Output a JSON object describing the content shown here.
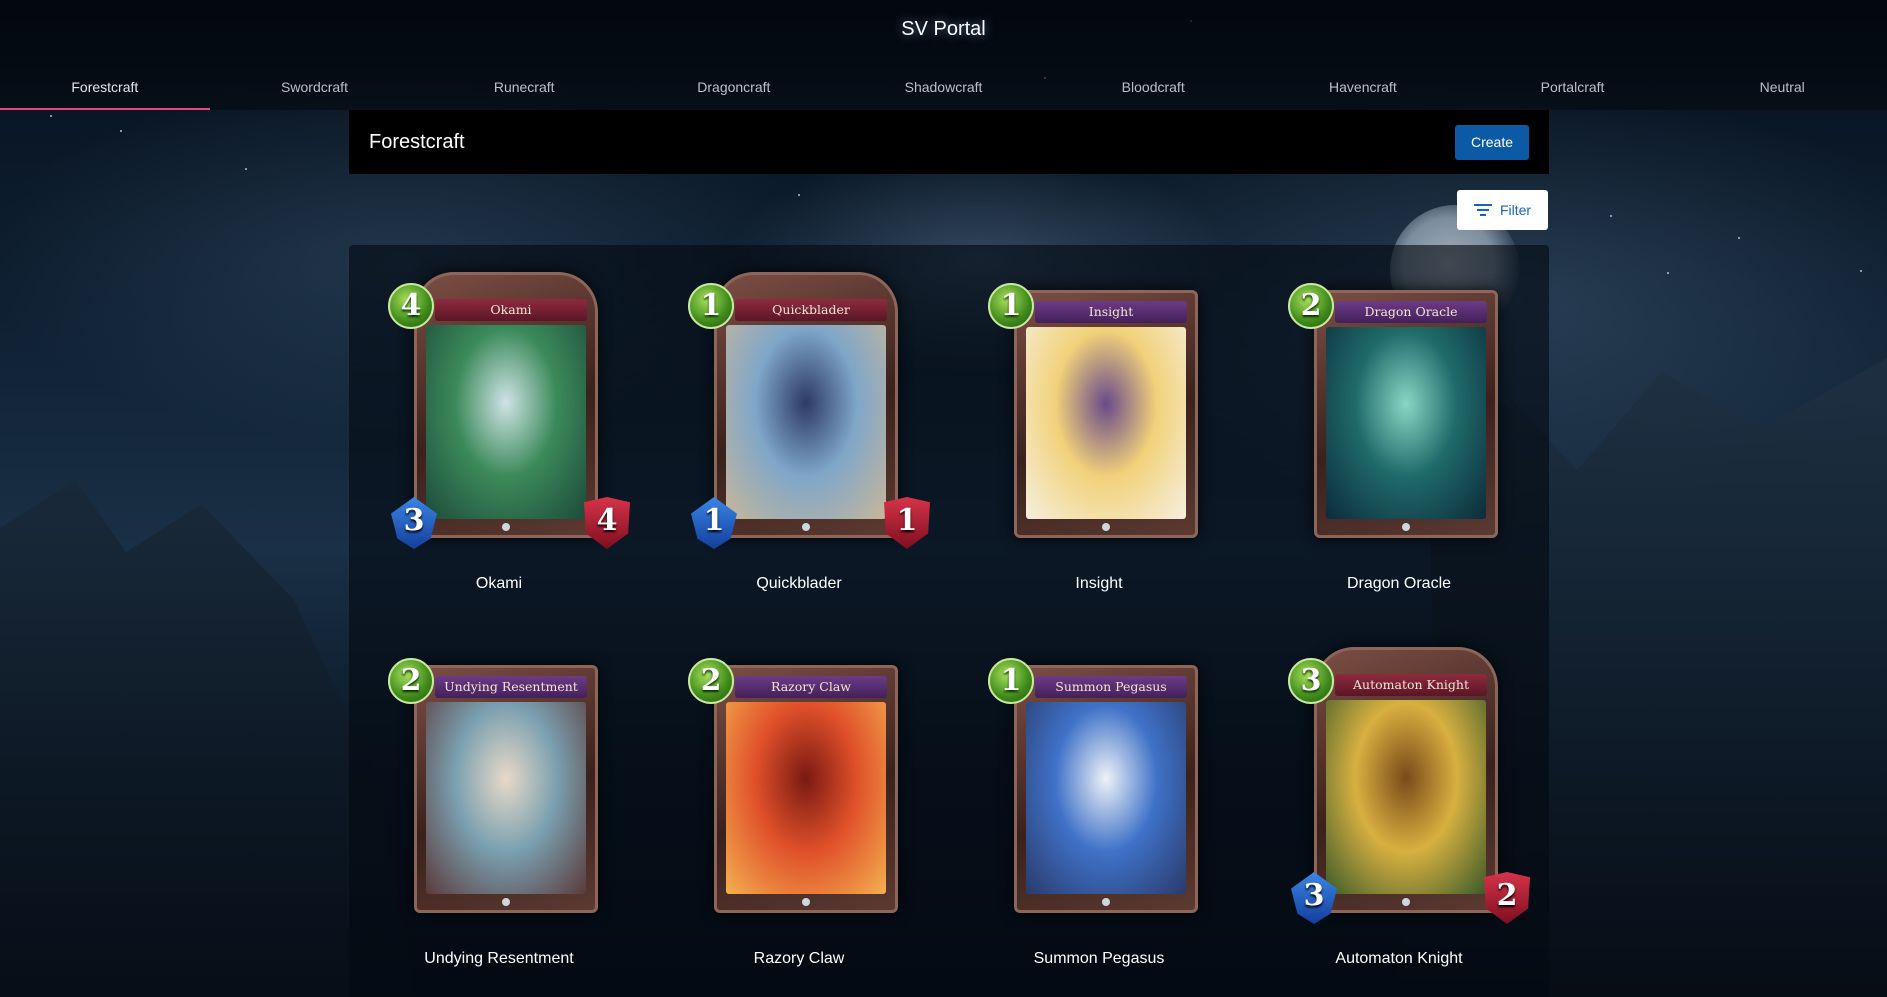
{
  "app": {
    "title": "SV Portal"
  },
  "tabs": [
    {
      "label": "Forestcraft",
      "active": true
    },
    {
      "label": "Swordcraft"
    },
    {
      "label": "Runecraft"
    },
    {
      "label": "Dragoncraft"
    },
    {
      "label": "Shadowcraft"
    },
    {
      "label": "Bloodcraft"
    },
    {
      "label": "Havencraft"
    },
    {
      "label": "Portalcraft"
    },
    {
      "label": "Neutral"
    }
  ],
  "page": {
    "title": "Forestcraft",
    "create_label": "Create",
    "filter_label": "Filter"
  },
  "cards": [
    {
      "name": "Okami",
      "banner": "Okami",
      "cost": "4",
      "attack": "3",
      "defense": "4",
      "type": "follower",
      "art_colors": [
        "#3b8a5a",
        "#cfe3e6",
        "#1d4a3a"
      ]
    },
    {
      "name": "Quickblader",
      "banner": "Quickblader",
      "cost": "1",
      "attack": "1",
      "defense": "1",
      "type": "follower",
      "art_colors": [
        "#7fa6c9",
        "#2d3a66",
        "#c8b79a"
      ]
    },
    {
      "name": "Insight",
      "banner": "Insight",
      "cost": "1",
      "type": "spell",
      "art_colors": [
        "#f1d27a",
        "#6a4a8a",
        "#f6efe0"
      ]
    },
    {
      "name": "Dragon Oracle",
      "banner": "Dragon Oracle",
      "cost": "2",
      "type": "spell",
      "art_colors": [
        "#1f6a6a",
        "#8ad6c4",
        "#0d2b3a"
      ]
    },
    {
      "name": "Undying Resentment",
      "banner": "Undying Resentment",
      "cost": "2",
      "type": "spell",
      "art_colors": [
        "#7aa0b0",
        "#e8d9c8",
        "#5a3a3a"
      ]
    },
    {
      "name": "Razory Claw",
      "banner": "Razory Claw",
      "cost": "2",
      "type": "spell",
      "art_colors": [
        "#e0502a",
        "#7a1a12",
        "#f4b050"
      ]
    },
    {
      "name": "Summon Pegasus",
      "banner": "Summon Pegasus",
      "cost": "1",
      "type": "spell",
      "art_colors": [
        "#3f72c8",
        "#eef2f6",
        "#2a3a6a"
      ]
    },
    {
      "name": "Automaton Knight",
      "banner": "Automaton Knight",
      "cost": "3",
      "attack": "3",
      "defense": "2",
      "type": "follower",
      "art_colors": [
        "#d8b040",
        "#7a4a1a",
        "#3a5a2a"
      ]
    }
  ]
}
